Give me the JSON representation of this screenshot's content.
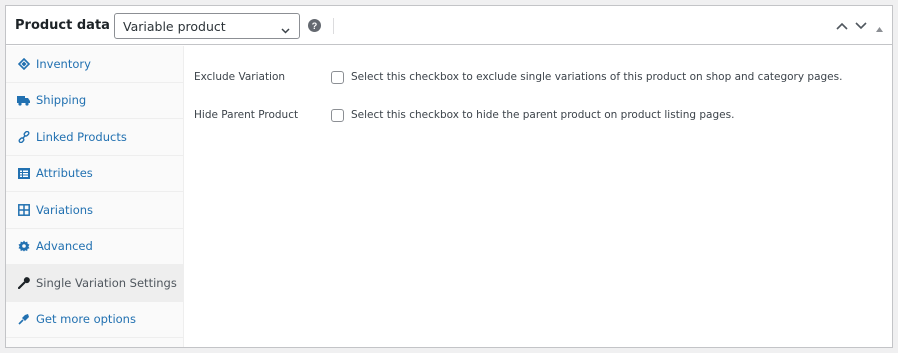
{
  "header": {
    "title": "Product data —",
    "product_type": "Variable product",
    "help": "?"
  },
  "sidebar": {
    "items": [
      {
        "label": "Inventory",
        "icon": "inventory-icon"
      },
      {
        "label": "Shipping",
        "icon": "truck-icon"
      },
      {
        "label": "Linked Products",
        "icon": "link-icon"
      },
      {
        "label": "Attributes",
        "icon": "list-icon"
      },
      {
        "label": "Variations",
        "icon": "grid-icon"
      },
      {
        "label": "Advanced",
        "icon": "gear-icon"
      },
      {
        "label": "Single Variation Settings",
        "icon": "wrench-icon",
        "active": true
      },
      {
        "label": "Get more options",
        "icon": "plugin-icon"
      }
    ]
  },
  "main": {
    "options": [
      {
        "label": "Exclude Variation",
        "description": "Select this checkbox to exclude single variations of this product on shop and category pages.",
        "checked": false
      },
      {
        "label": "Hide Parent Product",
        "description": "Select this checkbox to hide the parent product on product listing pages.",
        "checked": false
      }
    ]
  },
  "colors": {
    "link": "#2271b1",
    "active_tab_bg": "#eeeeee",
    "border": "#c3c4c7"
  }
}
